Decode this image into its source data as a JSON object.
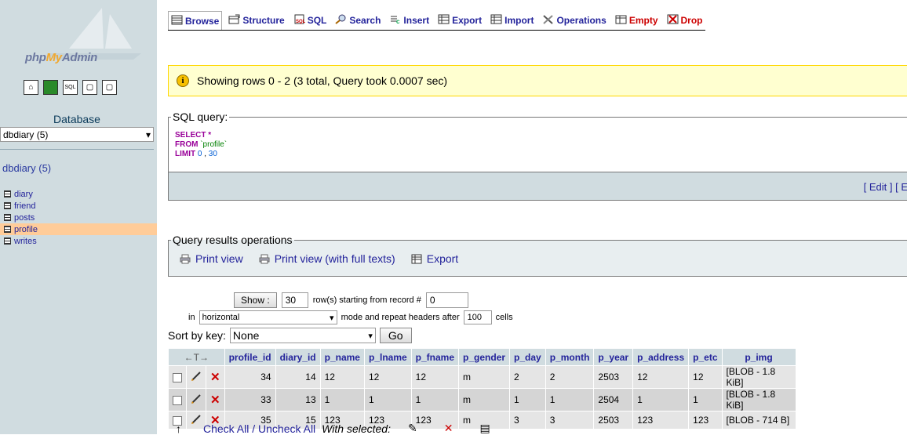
{
  "sidebar": {
    "logo": {
      "php": "php",
      "my": "My",
      "admin": "Admin"
    },
    "icons": [
      "home-icon",
      "database-icon",
      "sql-icon",
      "docs-icon",
      "docs-icon-2"
    ],
    "database_label": "Database",
    "database_select": "dbdiary (5)",
    "db_name": "dbdiary (5)",
    "tables": [
      {
        "name": "diary",
        "active": false
      },
      {
        "name": "friend",
        "active": false
      },
      {
        "name": "posts",
        "active": false
      },
      {
        "name": "profile",
        "active": true
      },
      {
        "name": "writes",
        "active": false
      }
    ]
  },
  "tabs": [
    {
      "label": "Browse",
      "icon": "browse-icon",
      "active": true,
      "red": false
    },
    {
      "label": "Structure",
      "icon": "structure-icon",
      "active": false,
      "red": false
    },
    {
      "label": "SQL",
      "icon": "sql-icon",
      "active": false,
      "red": false
    },
    {
      "label": "Search",
      "icon": "search-icon",
      "active": false,
      "red": false
    },
    {
      "label": "Insert",
      "icon": "insert-icon",
      "active": false,
      "red": false
    },
    {
      "label": "Export",
      "icon": "export-icon",
      "active": false,
      "red": false
    },
    {
      "label": "Import",
      "icon": "import-icon",
      "active": false,
      "red": false
    },
    {
      "label": "Operations",
      "icon": "operations-icon",
      "active": false,
      "red": false
    },
    {
      "label": "Empty",
      "icon": "empty-icon",
      "active": false,
      "red": true
    },
    {
      "label": "Drop",
      "icon": "drop-icon",
      "active": false,
      "red": true
    }
  ],
  "notice": {
    "icon": "i",
    "text": "Showing rows 0 - 2 (3 total, Query took 0.0007 sec)"
  },
  "sql_query": {
    "legend": "SQL query:",
    "select_kw": "SELECT",
    "select_rest": " *",
    "from_kw": "FROM",
    "table": " `profile`",
    "limit_kw": "LIMIT",
    "limit_a": " 0",
    "limit_sep": " , ",
    "limit_b": "30",
    "footer_links": "[ Edit ] [ E"
  },
  "query_results_ops": {
    "legend": "Query results operations",
    "print_view": "Print view",
    "print_view_full": "Print view (with full texts)",
    "export": "Export"
  },
  "nav": {
    "show_button": "Show :",
    "rows_value": "30",
    "rows_text": "row(s) starting from record #",
    "start_value": "0",
    "in_text": "in",
    "mode_value": "horizontal",
    "mode_text": "mode and repeat headers after",
    "repeat_value": "100",
    "cells_text": "cells"
  },
  "sort": {
    "label": "Sort by key:",
    "value": "None",
    "go": "Go"
  },
  "table": {
    "arrows": "←T→",
    "columns": [
      "profile_id",
      "diary_id",
      "p_name",
      "p_lname",
      "p_fname",
      "p_gender",
      "p_day",
      "p_month",
      "p_year",
      "p_address",
      "p_etc",
      "p_img"
    ],
    "rows": [
      [
        "34",
        "14",
        "12",
        "12",
        "12",
        "m",
        "2",
        "2",
        "2503",
        "12",
        "12",
        "[BLOB - 1.8 KiB]"
      ],
      [
        "33",
        "13",
        "1",
        "1",
        "1",
        "m",
        "1",
        "1",
        "2504",
        "1",
        "1",
        "[BLOB - 1.8 KiB]"
      ],
      [
        "35",
        "15",
        "123",
        "123",
        "123",
        "m",
        "3",
        "3",
        "2503",
        "123",
        "123",
        "[BLOB - 714 B]"
      ]
    ]
  },
  "bottom": {
    "check_all": "Check All / Uncheck All",
    "with_selected": "With selected:"
  },
  "colors": {
    "link": "#23239b",
    "sidebar_bg": "#d0dce0",
    "active_table": "#ffcc99",
    "notice_bg": "#ffffd0"
  }
}
